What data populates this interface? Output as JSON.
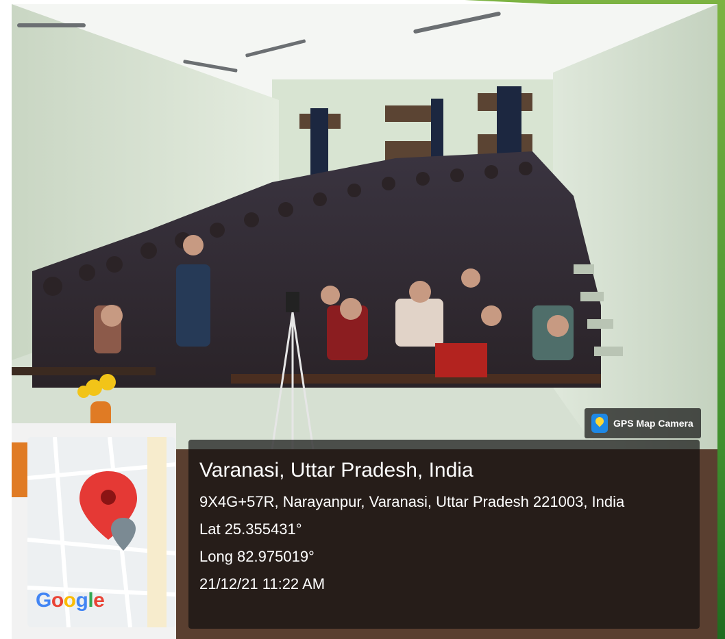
{
  "overlay": {
    "app_badge": "GPS Map Camera",
    "place_title": "Varanasi, Uttar Pradesh, India",
    "address": "9X4G+57R, Narayanpur, Varanasi, Uttar Pradesh 221003, India",
    "latitude": "Lat 25.355431°",
    "longitude": "Long 82.975019°",
    "datetime": "21/12/21 11:22 AM"
  },
  "map": {
    "brand_letters": [
      "G",
      "o",
      "o",
      "g",
      "l",
      "e"
    ]
  },
  "colors": {
    "accent_green": "#7cb342",
    "pin_red": "#e53935",
    "overlay_bg": "#0f0f0f"
  }
}
